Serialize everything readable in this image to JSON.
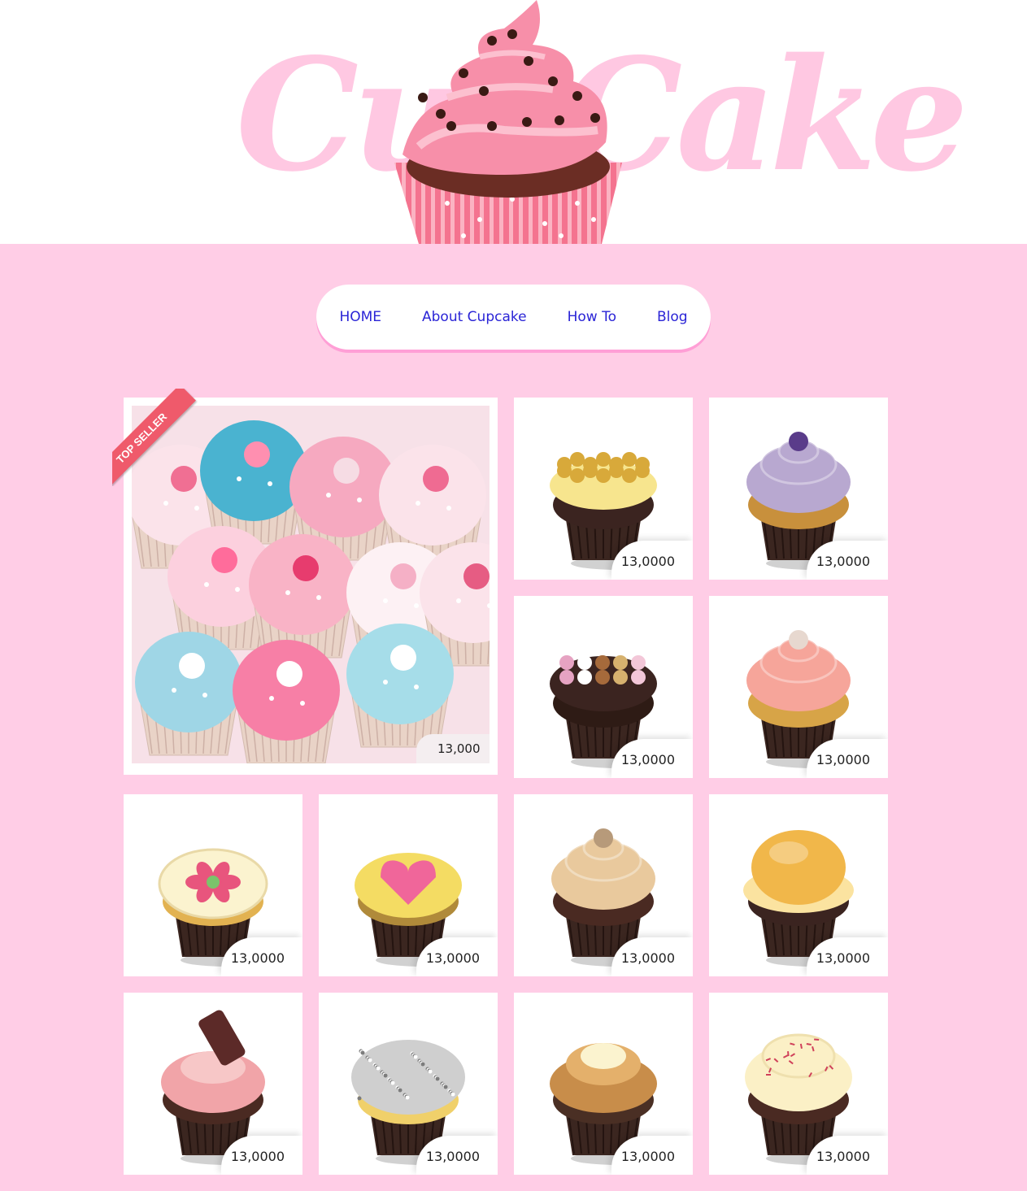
{
  "logo": {
    "text": "CupCake"
  },
  "nav": {
    "items": [
      {
        "label": "HOME"
      },
      {
        "label": "About Cupcake"
      },
      {
        "label": "How To"
      },
      {
        "label": "Blog"
      }
    ]
  },
  "featured": {
    "badge": "TOP SELLER",
    "price": "13,000"
  },
  "products": [
    {
      "price": "13,0000",
      "frosting": "#f7e58e",
      "topping": "#d8a93a",
      "cake": "#3b2420",
      "style": "crumble"
    },
    {
      "price": "13,0000",
      "frosting": "#b8a8d0",
      "topping": "#5a3c8a",
      "cake": "#c8903c",
      "style": "swirl"
    },
    {
      "price": "13,0000",
      "frosting": "#3b2420",
      "topping": "#e6a3c2",
      "cake": "#2e1b15",
      "style": "mix"
    },
    {
      "price": "13,0000",
      "frosting": "#f6a59a",
      "topping": "#e7d8cf",
      "cake": "#d7a447",
      "style": "swirl"
    },
    {
      "price": "13,0000",
      "frosting": "#fbf3cf",
      "topping": "#e8557d",
      "cake": "#e2b251",
      "style": "flower"
    },
    {
      "price": "13,0000",
      "frosting": "#f4dc63",
      "topping": "#f0669a",
      "cake": "#b08a3a",
      "style": "heart"
    },
    {
      "price": "13,0000",
      "frosting": "#e9c99d",
      "topping": "#b79a7a",
      "cake": "#4a2a22",
      "style": "swirl"
    },
    {
      "price": "13,0000",
      "frosting": "#f1b74a",
      "topping": "#fbe3a0",
      "cake": "#3b2420",
      "style": "puff"
    },
    {
      "price": "13,0000",
      "frosting": "#f1a4a8",
      "topping": "#5c2a28",
      "cake": "#4a2a22",
      "style": "wafer"
    },
    {
      "price": "13,0000",
      "frosting": "#cfcfcf",
      "topping": "#7c7c7c",
      "cake": "#f0d06a",
      "style": "coconut"
    },
    {
      "price": "13,0000",
      "frosting": "#c88d4a",
      "topping": "#fbf3cf",
      "cake": "#4a2f24",
      "style": "cream"
    },
    {
      "price": "13,0000",
      "frosting": "#fbf0c6",
      "topping": "#d0415a",
      "cake": "#4a2a22",
      "style": "sprinkle"
    }
  ],
  "colors": {
    "background": "#ffcde6",
    "nav_link": "#2a24d6",
    "ribbon": "#ef5a6b",
    "logo": "#ffc8e2"
  }
}
